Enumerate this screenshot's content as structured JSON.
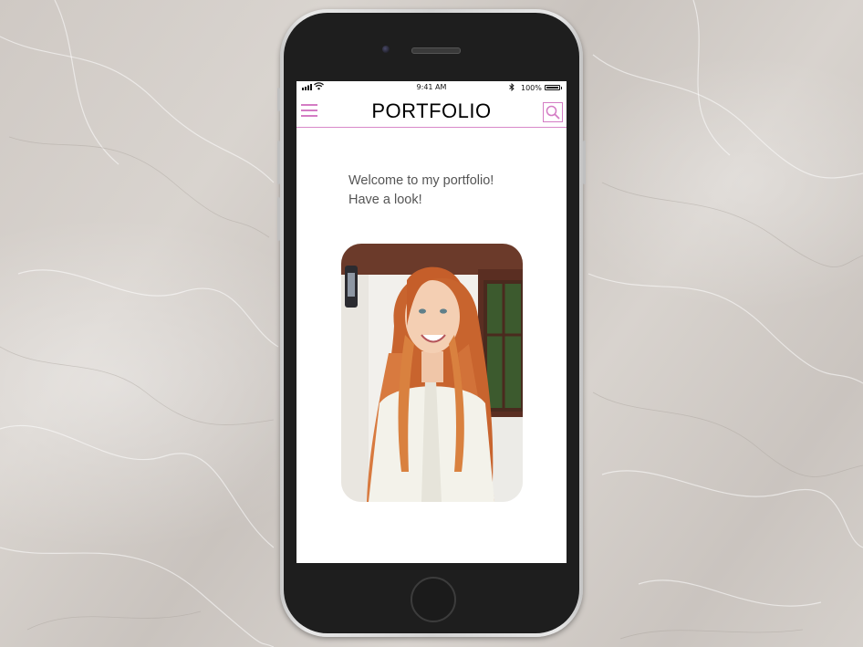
{
  "status_bar": {
    "time": "9:41 AM",
    "battery": "100%",
    "battery_level": 1.0,
    "icons": [
      "signal-icon",
      "wifi-icon",
      "bluetooth-icon",
      "battery-icon"
    ]
  },
  "nav": {
    "title": "PORTFOLIO",
    "menu_icon": "hamburger-menu-icon",
    "search_icon": "search-icon",
    "accent_color": "#d47cc4"
  },
  "main": {
    "welcome_line1": "Welcome to my portfolio!",
    "welcome_line2": "Have a look!",
    "photo": "profile-photo"
  }
}
